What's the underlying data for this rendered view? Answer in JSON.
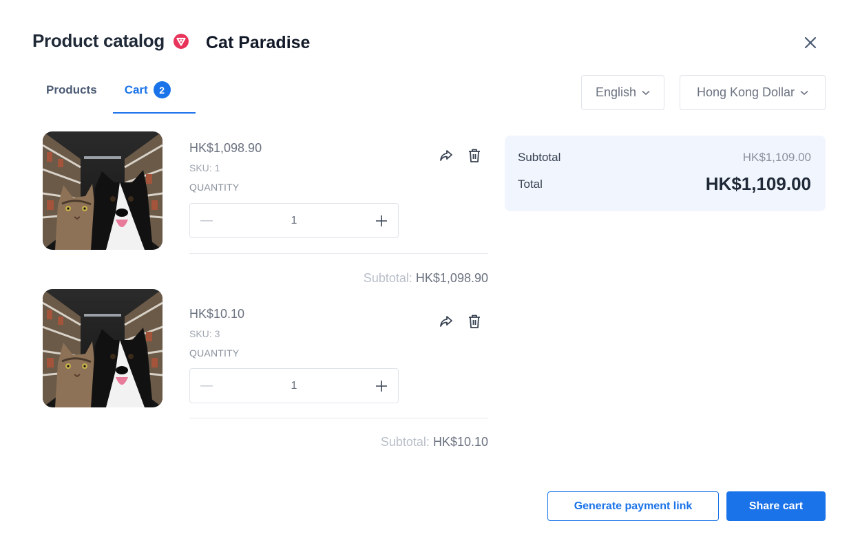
{
  "header": {
    "title": "Product catalog",
    "store_name": "Cat Paradise",
    "brand_icon": "store-shield-icon",
    "close_icon": "close-icon"
  },
  "tabs": [
    {
      "label": "Products",
      "active": false
    },
    {
      "label": "Cart",
      "active": true,
      "badge": "2"
    }
  ],
  "selectors": {
    "language": "English",
    "currency": "Hong Kong Dollar"
  },
  "cart": {
    "quantity_label": "QUANTITY",
    "subtotal_prefix": "Subtotal:",
    "items": [
      {
        "price": "HK$1,098.90",
        "sku": "SKU: 1",
        "quantity": "1",
        "subtotal": "HK$1,098.90"
      },
      {
        "price": "HK$10.10",
        "sku": "SKU: 3",
        "quantity": "1",
        "subtotal": "HK$10.10"
      }
    ]
  },
  "summary": {
    "subtotal_label": "Subtotal",
    "subtotal_value": "HK$1,109.00",
    "total_label": "Total",
    "total_value": "HK$1,109.00"
  },
  "actions": {
    "generate_link": "Generate payment link",
    "share_cart": "Share cart"
  },
  "colors": {
    "accent": "#1a73e8",
    "brand": "#e8345a",
    "summary_bg": "#f1f5fd"
  }
}
